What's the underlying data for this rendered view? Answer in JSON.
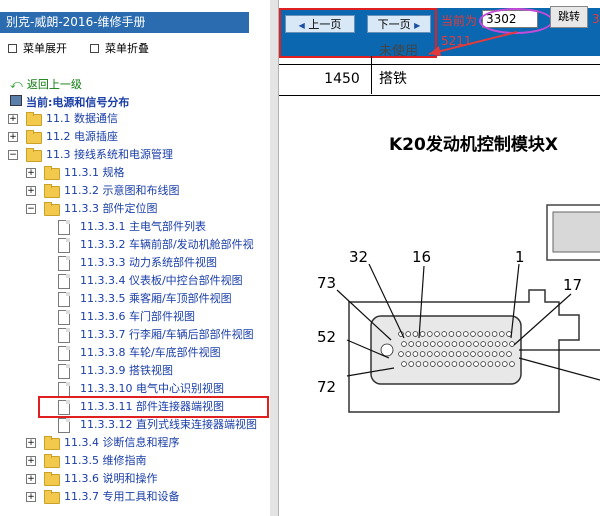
{
  "window": {
    "title": "别克-威朗-2016-维修手册"
  },
  "menu": {
    "expand": "菜单展开",
    "collapse": "菜单折叠"
  },
  "back": {
    "label": "返回上一级"
  },
  "current": {
    "label": "当前:电源和信号分布"
  },
  "tree": [
    {
      "label": "11.1 数据通信"
    },
    {
      "label": "11.2 电源插座"
    },
    {
      "label": "11.3 接线系统和电源管理"
    },
    {
      "label": "11.3.1 规格"
    },
    {
      "label": "11.3.2 示意图和布线图"
    },
    {
      "label": "11.3.3 部件定位图"
    },
    {
      "label": "11.3.3.1 主电气部件列表"
    },
    {
      "label": "11.3.3.2 车辆前部/发动机舱部件视"
    },
    {
      "label": "11.3.3.3 动力系统部件视图"
    },
    {
      "label": "11.3.3.4 仪表板/中控台部件视图"
    },
    {
      "label": "11.3.3.5 乘客厢/车顶部件视图"
    },
    {
      "label": "11.3.3.6 车门部件视图"
    },
    {
      "label": "11.3.3.7 行李厢/车辆后部部件视图"
    },
    {
      "label": "11.3.3.8 车轮/车底部件视图"
    },
    {
      "label": "11.3.3.9 搭铁视图"
    },
    {
      "label": "11.3.3.10 电气中心识别视图"
    },
    {
      "label": "11.3.3.11 部件连接器端视图"
    },
    {
      "label": "11.3.3.12 直列式线束连接器端视图"
    },
    {
      "label": "11.3.4 诊断信息和程序"
    },
    {
      "label": "11.3.5 维修指南"
    },
    {
      "label": "11.3.6 说明和操作"
    },
    {
      "label": "11.3.7 专用工具和设备"
    }
  ],
  "nav": {
    "prev_label": "上一页",
    "next_label": "下一页",
    "current_label": "当前为",
    "page_value": "3302",
    "jump_label": "跳转",
    "total": "5211",
    "red_number": "33"
  },
  "table": {
    "number": "1450",
    "name": "搭铁",
    "prev_row_text": "未使用"
  },
  "document": {
    "title": "K20发动机控制模块X",
    "pins": [
      "73",
      "32",
      "16",
      "1",
      "17",
      "52",
      "72"
    ]
  },
  "colors": {
    "accent": "#0b67b0",
    "highlight": "#e02020",
    "oval": "#c54ad8",
    "link": "#1a3ea8"
  }
}
